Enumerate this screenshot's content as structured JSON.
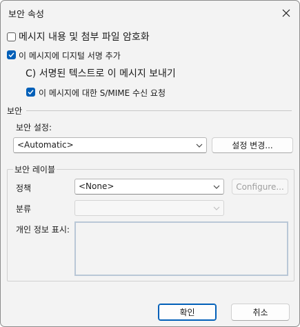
{
  "window": {
    "title": "보안 속성"
  },
  "options": {
    "encrypt_label": "메시지 내용 및 첨부 파일 암호화",
    "sign_label": "이 메시지에 디지털 서명 추가",
    "send_clear_label": "C) 서명된 텍스트로 이 메시지 보내기",
    "smime_receipt_label": "이 메시지에 대한 S/MIME 수신 요청",
    "encrypt_checked": false,
    "sign_checked": true,
    "smime_receipt_checked": true
  },
  "security": {
    "group_title": "보안",
    "settings_label": "보안 설정:",
    "settings_value": "<Automatic>",
    "change_settings_button": "설정 변경..."
  },
  "security_label": {
    "group_title": "보안 레이블",
    "policy_label": "정책",
    "policy_value": "<None>",
    "configure_button": "Configure...",
    "classification_label": "분류",
    "classification_value": "",
    "privacy_label": "개인 정보 표시:"
  },
  "footer": {
    "ok_button": "확인",
    "cancel_button": "취소"
  },
  "colors": {
    "accent": "#005fb8",
    "dialog_bg": "#f3f3f3"
  }
}
